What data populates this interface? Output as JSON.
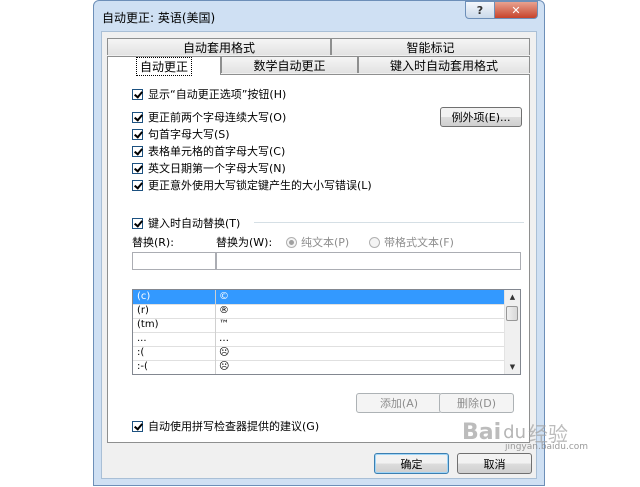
{
  "window": {
    "title": "自动更正: 英语(美国)",
    "help_glyph": "?",
    "close_glyph": "✕"
  },
  "tabs": {
    "top_row": [
      "自动套用格式",
      "智能标记"
    ],
    "bottom_row": [
      "自动更正",
      "数学自动更正",
      "键入时自动套用格式"
    ],
    "active": "自动更正"
  },
  "options": {
    "show_button": "显示“自动更正选项”按钮(H)",
    "items": [
      "更正前两个字母连续大写(O)",
      "句首字母大写(S)",
      "表格单元格的首字母大写(C)",
      "英文日期第一个字母大写(N)",
      "更正意外使用大写锁定键产生的大小写错误(L)"
    ],
    "exceptions_button": "例外项(E)..."
  },
  "replace_group": {
    "checkbox": "键入时自动替换(T)",
    "replace_label": "替换(R):",
    "with_label": "替换为(W):",
    "plain_text": "纯文本(P)",
    "formatted_text": "带格式文本(F)",
    "replace_value": "",
    "with_value": ""
  },
  "table": {
    "rows": [
      {
        "from": "(c)",
        "to": "©",
        "selected": true
      },
      {
        "from": "(r)",
        "to": "®",
        "selected": false
      },
      {
        "from": "(tm)",
        "to": "™",
        "selected": false
      },
      {
        "from": "...",
        "to": "…",
        "selected": false
      },
      {
        "from": ":(",
        "to": "☹",
        "selected": false
      },
      {
        "from": ":-(",
        "to": "☹",
        "selected": false
      }
    ]
  },
  "buttons": {
    "add": "添加(A)",
    "delete": "删除(D)",
    "ok": "确定",
    "cancel": "取消"
  },
  "spell_checkbox": "自动使用拼写检查器提供的建议(G)",
  "watermark": {
    "logo": "Bai",
    "paw": "du",
    "text": "经验",
    "url": "jingyan.baidu.com"
  },
  "colors": {
    "selection": "#3399ff",
    "frame": "#cfe0f3",
    "close": "#c7432b"
  }
}
